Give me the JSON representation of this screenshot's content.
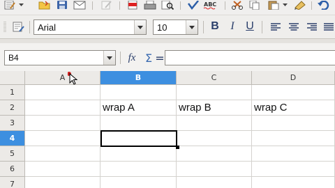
{
  "toolbar_standard": {
    "icons": [
      "edit-file-icon",
      "open-icon",
      "save-icon",
      "email-icon",
      "edit-mode-icon",
      "export-pdf-icon",
      "print-icon",
      "page-preview-icon",
      "spellcheck-icon",
      "autospellcheck-icon",
      "cut-icon",
      "copy-icon",
      "paste-icon",
      "clone-format-icon",
      "undo-icon"
    ],
    "spellcheck_text": "ABC"
  },
  "toolbar_format": {
    "font_name": "Arial",
    "font_size": "10",
    "bold_label": "B",
    "italic_label": "I",
    "underline_label": "U"
  },
  "formula_bar": {
    "name_box": "B4",
    "function_wizard_label": "fx",
    "sum_label": "Σ",
    "equals_label": "=",
    "formula_value": ""
  },
  "sheet": {
    "columns": [
      "A",
      "B",
      "C",
      "D"
    ],
    "active_column": "B",
    "rows": [
      "1",
      "2",
      "3",
      "4",
      "5",
      "6",
      "7"
    ],
    "active_row": "4",
    "cells": {
      "B2": "wrap A",
      "C2": "wrap B",
      "D2": "wrap C"
    },
    "selected_cell": "B4"
  },
  "colors": {
    "active_header": "#3d8fe0",
    "toolbar_bg": "#f0efee",
    "grid_line": "#d4d2ce",
    "format_icon": "#2b3f6b"
  }
}
